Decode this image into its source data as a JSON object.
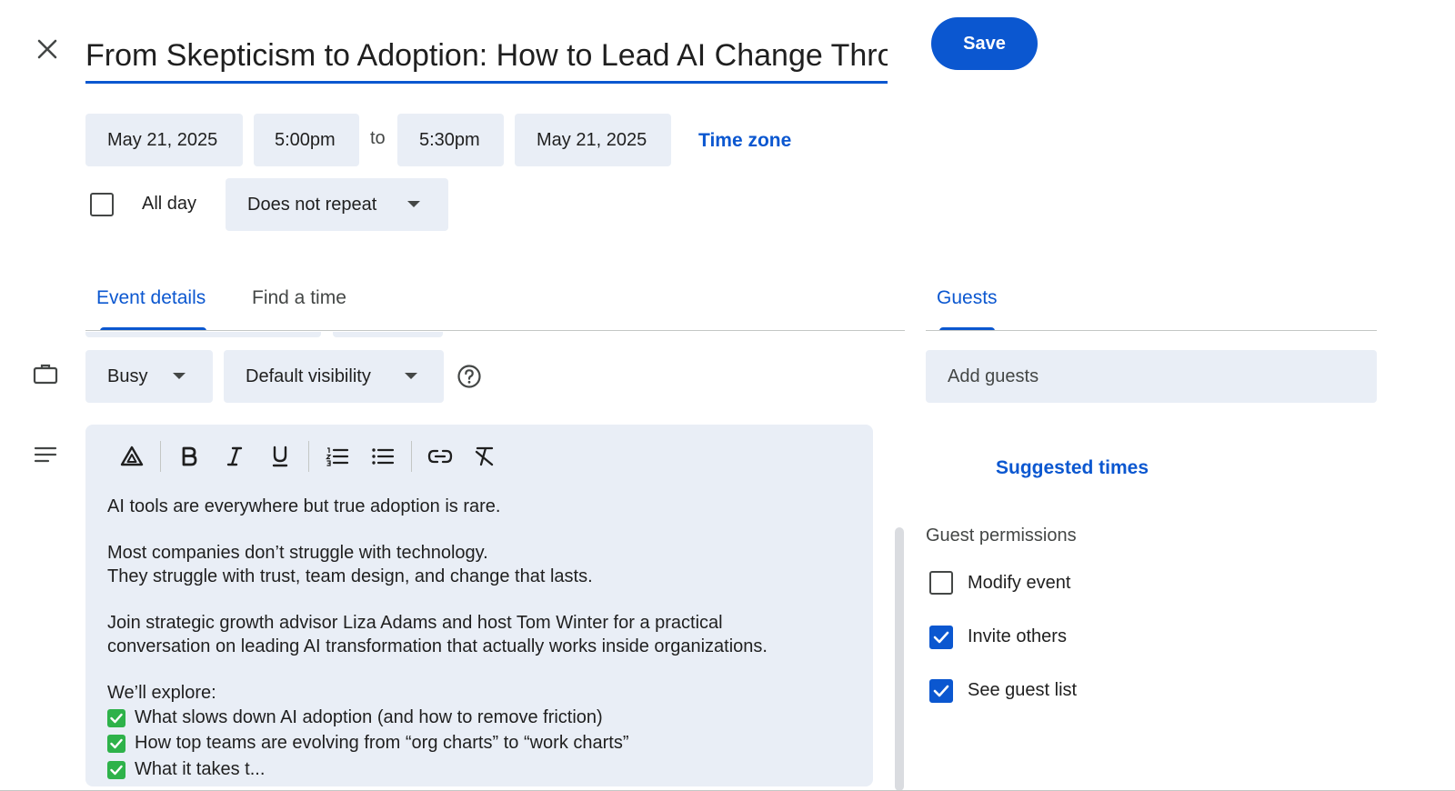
{
  "header": {
    "title": "From Skepticism to Adoption: How to Lead AI Change Thro",
    "save_label": "Save"
  },
  "datetime": {
    "start_date": "May 21, 2025",
    "start_time": "5:00pm",
    "to_label": "to",
    "end_time": "5:30pm",
    "end_date": "May 21, 2025",
    "time_zone_label": "Time zone"
  },
  "all_day": {
    "label": "All day",
    "checked": false
  },
  "repeat": {
    "selected": "Does not repeat"
  },
  "tabs": [
    {
      "label": "Event details",
      "active": true
    },
    {
      "label": "Find a time",
      "active": false
    }
  ],
  "availability": {
    "selected": "Busy"
  },
  "visibility": {
    "selected": "Default visibility"
  },
  "description": {
    "paragraphs": [
      "AI tools are everywhere but true adoption is rare.",
      "",
      "Most companies don’t struggle with technology.",
      "They struggle with trust, team design, and change that lasts.",
      "",
      "Join strategic growth advisor Liza Adams and host Tom Winter for a practical",
      "conversation on leading AI transformation that actually works inside organizations.",
      "",
      "We’ll explore:"
    ],
    "checklist": [
      "What slows down AI adoption (and how to remove friction)",
      "How top teams are evolving from “org charts” to “work charts”",
      "What it takes t..."
    ]
  },
  "guests": {
    "tab_label": "Guests",
    "input_placeholder": "Add guests",
    "suggested_times_label": "Suggested times",
    "permissions_heading": "Guest permissions",
    "permissions": [
      {
        "label": "Modify event",
        "checked": false
      },
      {
        "label": "Invite others",
        "checked": true
      },
      {
        "label": "See guest list",
        "checked": true
      }
    ]
  },
  "colors": {
    "accent": "#0b57d0",
    "chip_bg": "#e9eef6",
    "check_green": "#2eb24a"
  }
}
